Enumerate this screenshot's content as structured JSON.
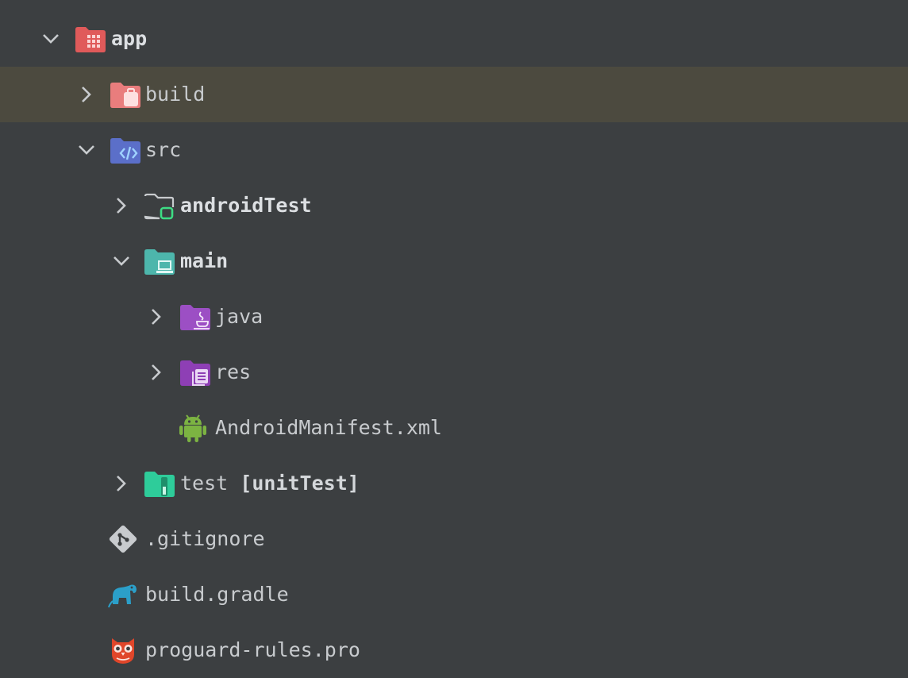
{
  "tree": {
    "app": {
      "label": "app",
      "icon": "module-folder-icon",
      "expanded": true
    },
    "build": {
      "label": "build",
      "icon": "build-folder-icon",
      "expanded": false,
      "selected": true
    },
    "src": {
      "label": "src",
      "icon": "source-folder-icon",
      "expanded": true
    },
    "androidTest": {
      "label": "androidTest",
      "icon": "android-test-folder-icon",
      "expanded": false
    },
    "main": {
      "label": "main",
      "icon": "main-folder-icon",
      "expanded": true
    },
    "java": {
      "label": "java",
      "icon": "java-folder-icon",
      "expanded": false
    },
    "res": {
      "label": "res",
      "icon": "resources-folder-icon",
      "expanded": false
    },
    "manifest": {
      "label": "AndroidManifest.xml",
      "icon": "android-icon"
    },
    "test": {
      "label": "test",
      "suffix": "[unitTest]",
      "icon": "test-folder-icon",
      "expanded": false
    },
    "gitignore": {
      "label": ".gitignore",
      "icon": "git-icon"
    },
    "buildGradle": {
      "label": "build.gradle",
      "icon": "gradle-elephant-icon"
    },
    "proguard": {
      "label": "proguard-rules.pro",
      "icon": "proguard-owl-icon"
    }
  },
  "colors": {
    "background": "#3c3f41",
    "selection": "#4c4a3f",
    "text": "#c8cbce",
    "module_red": "#e05a5a",
    "build_pink": "#e97d7d",
    "src_blue": "#5b6fc9",
    "main_teal": "#4db6ac",
    "java_purple": "#9c4fc4",
    "res_purple": "#8e3fb5",
    "android_green": "#7cb342",
    "test_green": "#2ecc9a",
    "gradle_blue": "#2b9fc9",
    "owl_red": "#e0462a"
  }
}
